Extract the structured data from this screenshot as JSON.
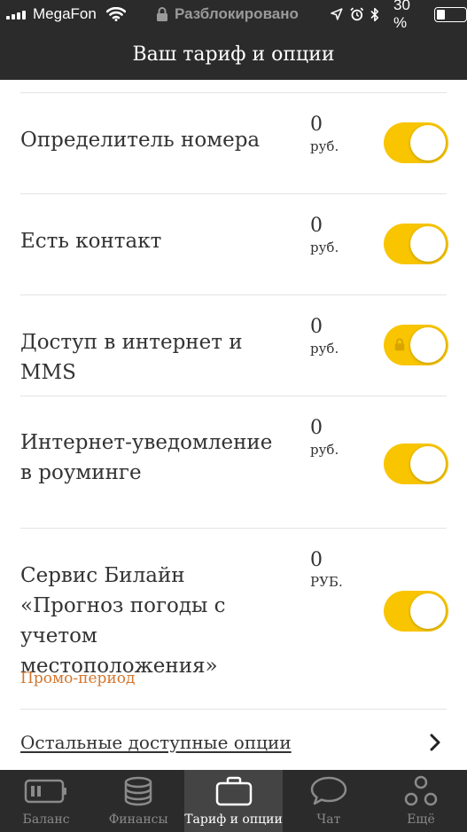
{
  "status_bar": {
    "carrier": "MegaFon",
    "lock_text": "Разблокировано",
    "battery_percent": "30 %",
    "battery_level": 0.3,
    "icons": [
      "signal-icon",
      "wifi-icon",
      "lock-icon",
      "location-icon",
      "alarm-icon",
      "bluetooth-icon",
      "battery-icon"
    ]
  },
  "header": {
    "title": "Ваш тариф и опции"
  },
  "options": [
    {
      "label": "Определитель номера",
      "amount": "0",
      "unit": "руб.",
      "enabled": true,
      "locked": false
    },
    {
      "label": "Есть контакт",
      "amount": "0",
      "unit": "руб.",
      "enabled": true,
      "locked": false
    },
    {
      "label": "Доступ в интернет и MMS",
      "amount": "0",
      "unit": "руб.",
      "enabled": true,
      "locked": true
    },
    {
      "label": "Интернет-уведомление в роуминге",
      "amount": "0",
      "unit": "руб.",
      "enabled": true,
      "locked": false
    },
    {
      "label": "Сервис Билайн «Прогноз погоды с учетом местоположения»",
      "amount": "0",
      "unit": "РУБ.",
      "enabled": true,
      "locked": false,
      "note": "Промо-период"
    }
  ],
  "more_options_link": "Остальные доступные опции",
  "colors": {
    "accent": "#f8c500",
    "bar_bg": "#2b2b2b",
    "promo": "#d4762e",
    "active_tab_bg": "#444444"
  },
  "tabs": [
    {
      "label": "Баланс",
      "icon": "battery-icon",
      "active": false
    },
    {
      "label": "Финансы",
      "icon": "coins-icon",
      "active": false
    },
    {
      "label": "Тариф и опции",
      "icon": "briefcase-icon",
      "active": true
    },
    {
      "label": "Чат",
      "icon": "chat-bubble-icon",
      "active": false
    },
    {
      "label": "Ещё",
      "icon": "more-circles-icon",
      "active": false
    }
  ]
}
